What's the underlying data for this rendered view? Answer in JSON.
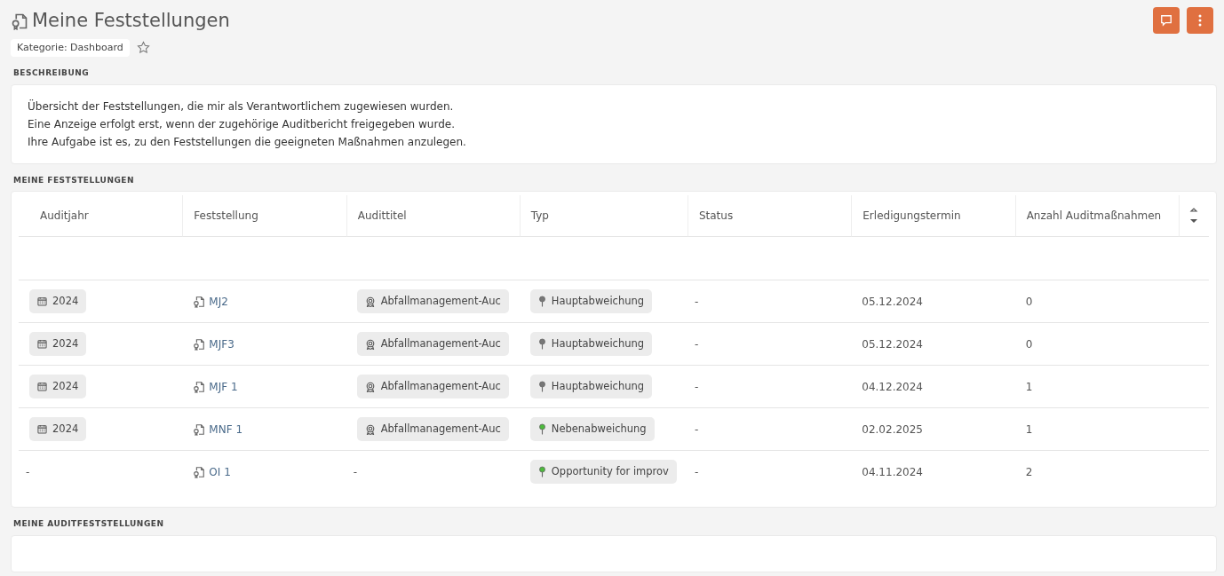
{
  "page": {
    "title": "Meine Feststellungen",
    "category": "Kategorie: Dashboard",
    "favorite": false
  },
  "description": {
    "heading": "BESCHREIBUNG",
    "lines": [
      "Übersicht der Feststellungen, die mir als Verantwortlichem zugewiesen wurden.",
      "Eine Anzeige erfolgt erst, wenn der zugehörige Auditbericht freigegeben wurde.",
      "Ihre Aufgabe ist es, zu den Feststellungen die geeigneten Maßnahmen anzulegen."
    ]
  },
  "table_section": {
    "heading": "MEINE FESTSTELLUNGEN",
    "columns": [
      "Auditjahr",
      "Feststellung",
      "Audittitel",
      "Typ",
      "Status",
      "Erledigungstermin",
      "Anzahl Auditmaßnahmen"
    ],
    "rows": [
      {
        "year": "2024",
        "finding": "MJ2",
        "audit": "Abfallmanagement-Auc",
        "type": "Hauptabweichung",
        "color": "#777777",
        "status": "-",
        "due": "05.12.2024",
        "count": "0"
      },
      {
        "year": "2024",
        "finding": "MJF3",
        "audit": "Abfallmanagement-Auc",
        "type": "Hauptabweichung",
        "color": "#777777",
        "status": "-",
        "due": "05.12.2024",
        "count": "0"
      },
      {
        "year": "2024",
        "finding": "MJF 1",
        "audit": "Abfallmanagement-Auc",
        "type": "Hauptabweichung",
        "color": "#777777",
        "status": "-",
        "due": "04.12.2024",
        "count": "1"
      },
      {
        "year": "2024",
        "finding": "MNF 1",
        "audit": "Abfallmanagement-Auc",
        "type": "Nebenabweichung",
        "color": "#4cbb3c",
        "status": "-",
        "due": "02.02.2025",
        "count": "1"
      },
      {
        "year": "-",
        "finding": "OI 1",
        "audit": "-",
        "type": "Opportunity for improv",
        "color": "#4cbb3c",
        "status": "-",
        "due": "04.11.2024",
        "count": "2"
      }
    ]
  },
  "audit_section": {
    "heading": "MEINE AUDITFESTSTELLUNGEN"
  }
}
